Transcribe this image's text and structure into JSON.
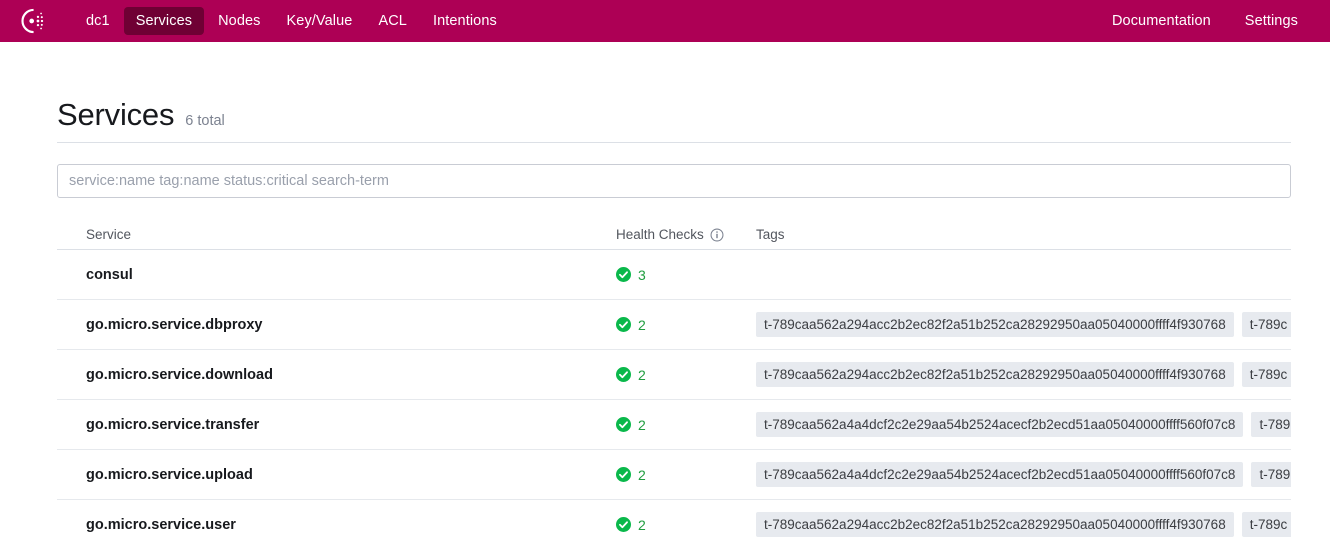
{
  "nav": {
    "logo_name": "consul-logo",
    "background": "#ad0055",
    "active_background": "#6f0034",
    "left_items": [
      {
        "label": "dc1",
        "name": "nav-item-dc1",
        "active": false
      },
      {
        "label": "Services",
        "name": "nav-item-services",
        "active": true
      },
      {
        "label": "Nodes",
        "name": "nav-item-nodes",
        "active": false
      },
      {
        "label": "Key/Value",
        "name": "nav-item-keyvalue",
        "active": false
      },
      {
        "label": "ACL",
        "name": "nav-item-acl",
        "active": false
      },
      {
        "label": "Intentions",
        "name": "nav-item-intentions",
        "active": false
      }
    ],
    "right_items": [
      {
        "label": "Documentation",
        "name": "nav-item-documentation"
      },
      {
        "label": "Settings",
        "name": "nav-item-settings"
      }
    ]
  },
  "header": {
    "title": "Services",
    "count": "6 total"
  },
  "search": {
    "value": "",
    "placeholder": "service:name tag:name status:critical search-term"
  },
  "table": {
    "columns": {
      "service": "Service",
      "health": "Health Checks",
      "health_info_icon": "info-icon",
      "tags": "Tags"
    },
    "rows": [
      {
        "service": "consul",
        "health_count": "3",
        "health_status": "passing",
        "health_icon": "check-circle-icon",
        "tags": []
      },
      {
        "service": "go.micro.service.dbproxy",
        "health_count": "2",
        "health_status": "passing",
        "health_icon": "check-circle-icon",
        "tags": [
          "t-789caa562a294acc2b2ec82f2a51b252ca28292950aa05040000ffff4f930768",
          "t-789c"
        ]
      },
      {
        "service": "go.micro.service.download",
        "health_count": "2",
        "health_status": "passing",
        "health_icon": "check-circle-icon",
        "tags": [
          "t-789caa562a294acc2b2ec82f2a51b252ca28292950aa05040000ffff4f930768",
          "t-789c"
        ]
      },
      {
        "service": "go.micro.service.transfer",
        "health_count": "2",
        "health_status": "passing",
        "health_icon": "check-circle-icon",
        "tags": [
          "t-789caa562a4a4dcf2c2e29aa54b2524acecf2b2ecd51aa05040000ffff560f07c8",
          "t-789"
        ]
      },
      {
        "service": "go.micro.service.upload",
        "health_count": "2",
        "health_status": "passing",
        "health_icon": "check-circle-icon",
        "tags": [
          "t-789caa562a4a4dcf2c2e29aa54b2524acecf2b2ecd51aa05040000ffff560f07c8",
          "t-789"
        ]
      },
      {
        "service": "go.micro.service.user",
        "health_count": "2",
        "health_status": "passing",
        "health_icon": "check-circle-icon",
        "tags": [
          "t-789caa562a294acc2b2ec82f2a51b252ca28292950aa05040000ffff4f930768",
          "t-789c"
        ]
      }
    ]
  },
  "colors": {
    "brand": "#ad0055",
    "brand_active": "#6f0034",
    "health_passing": "#1f9d3f",
    "tag_background": "#e7eaef"
  }
}
